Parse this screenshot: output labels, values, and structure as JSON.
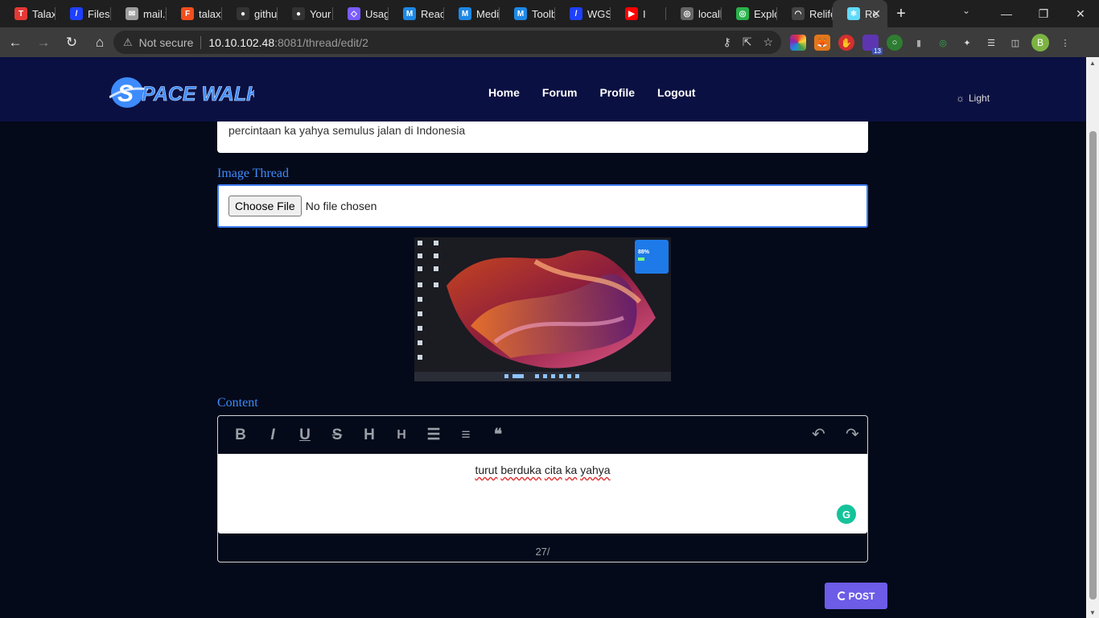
{
  "browser": {
    "tabs": [
      {
        "title": "Talaxy",
        "icon": "trello-icon",
        "color": "#e53935",
        "glyph": "T"
      },
      {
        "title": "Files",
        "icon": "files-icon",
        "color": "#1e40ff",
        "glyph": "/"
      },
      {
        "title": "mail.yahoo",
        "icon": "mail-icon",
        "color": "#9e9e9e",
        "glyph": "✉"
      },
      {
        "title": "talaxy",
        "icon": "figma-icon",
        "color": "#f24e1e",
        "glyph": "F"
      },
      {
        "title": "github",
        "icon": "github-icon",
        "color": "#333333",
        "glyph": "●"
      },
      {
        "title": "Your",
        "icon": "github-icon",
        "color": "#333333",
        "glyph": "●"
      },
      {
        "title": "Usage",
        "icon": "graphql-icon",
        "color": "#7b5cff",
        "glyph": "◇"
      },
      {
        "title": "React",
        "icon": "mui-icon",
        "color": "#1e88e5",
        "glyph": "M"
      },
      {
        "title": "Media",
        "icon": "mui-icon",
        "color": "#1e88e5",
        "glyph": "M"
      },
      {
        "title": "Toolbar",
        "icon": "mui-icon",
        "color": "#1e88e5",
        "glyph": "M"
      },
      {
        "title": "WGS",
        "icon": "files-icon",
        "color": "#1e40ff",
        "glyph": "/"
      },
      {
        "title": "I",
        "icon": "youtube-icon",
        "color": "#ff0000",
        "glyph": "▶"
      },
      {
        "title": "localhost",
        "icon": "globe-icon",
        "color": "#666666",
        "glyph": "◎"
      },
      {
        "title": "Explorer",
        "icon": "compass-icon",
        "color": "#2bb24c",
        "glyph": "◎"
      },
      {
        "title": "Relife",
        "icon": "relife-icon",
        "color": "#444444",
        "glyph": "◠"
      },
      {
        "title": "Re",
        "icon": "react-icon",
        "color": "#61dafb",
        "glyph": "⚛"
      }
    ],
    "tab_search_icon": "chevron-down-icon",
    "window_controls": [
      "—",
      "❐",
      "✕"
    ],
    "address": {
      "security_label": "Not secure",
      "host": "10.10.102.48",
      "path": ":8081/thread/edit/2"
    },
    "extension_badge": "13",
    "profile_initial": "B"
  },
  "site": {
    "brand": "SPACE WALK",
    "brand_initial": "S",
    "brand_rest": "PACE WALK",
    "nav": [
      "Home",
      "Forum",
      "Profile",
      "Logout"
    ],
    "theme_toggle": "Light",
    "accent": "#3d8bfd"
  },
  "form": {
    "title_value": "percintaan ka yahya semulus jalan di Indonesia",
    "image_label": "Image Thread",
    "choose_file": "Choose File",
    "no_file": "No file chosen",
    "preview_widget_value": "88%",
    "content_label": "Content",
    "toolbar": [
      "B",
      "I",
      "U",
      "S",
      "H",
      "H",
      "☰",
      "≡",
      "❝"
    ],
    "toolbar_icons": [
      "bold-icon",
      "italic-icon",
      "underline-icon",
      "strikethrough-icon",
      "heading1-icon",
      "heading2-icon",
      "bullet-list-icon",
      "numbered-list-icon",
      "quote-icon"
    ],
    "undo": "↶",
    "redo": "↷",
    "words": [
      "turut",
      "berduka",
      "cita",
      "ka",
      "yahya"
    ],
    "char_count": "27/",
    "grammarly": "G",
    "post_label": "POST"
  }
}
